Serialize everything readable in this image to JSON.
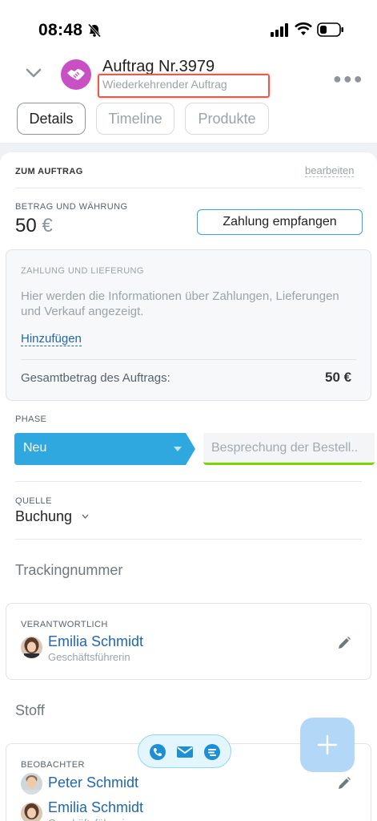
{
  "status_bar": {
    "time": "08:48",
    "icons": [
      "bell-muted-icon",
      "signal-icon",
      "wifi-icon",
      "battery-icon"
    ]
  },
  "header": {
    "title": "Auftrag Nr.3979",
    "subtitle": "Wiederkehrender Auftrag",
    "more_icon": "more-icon",
    "avatar_color": "#c94fc4"
  },
  "tabs": [
    {
      "label": "Details",
      "active": true
    },
    {
      "label": "Timeline",
      "active": false
    },
    {
      "label": "Produkte",
      "active": false
    }
  ],
  "section": {
    "title": "ZUM AUFTRAG",
    "edit_label": "bearbeiten"
  },
  "amount": {
    "label": "BETRAG UND WÄHRUNG",
    "value": "50",
    "currency": "€",
    "pay_button": "Zahlung empfangen"
  },
  "payment": {
    "label": "ZAHLUNG UND LIEFERUNG",
    "text": "Hier werden die Informationen über Zahlungen, Lieferungen und Verkauf angezeigt.",
    "add_link": "Hinzufügen",
    "total_label": "Gesamtbetrag des Auftrags:",
    "total_value": "50 €"
  },
  "phase": {
    "label": "PHASE",
    "current": "Neu",
    "next": "Besprechung der Bestell..",
    "current_color": "#2fa8e0",
    "next_color": "#7bd500"
  },
  "source": {
    "label": "QUELLE",
    "value": "Buchung"
  },
  "fields": {
    "tracking": "Trackingnummer",
    "material": "Stoff"
  },
  "responsible": {
    "label": "VERANTWORTLICH",
    "name": "Emilia Schmidt",
    "role": "Geschäftsführerin"
  },
  "observers": {
    "label": "BEOBACHTER",
    "people": [
      {
        "name": "Peter Schmidt",
        "role": ""
      },
      {
        "name": "Emilia Schmidt",
        "role": "Geschäftsführerin"
      }
    ]
  },
  "accent_color": "#2fa8e0"
}
